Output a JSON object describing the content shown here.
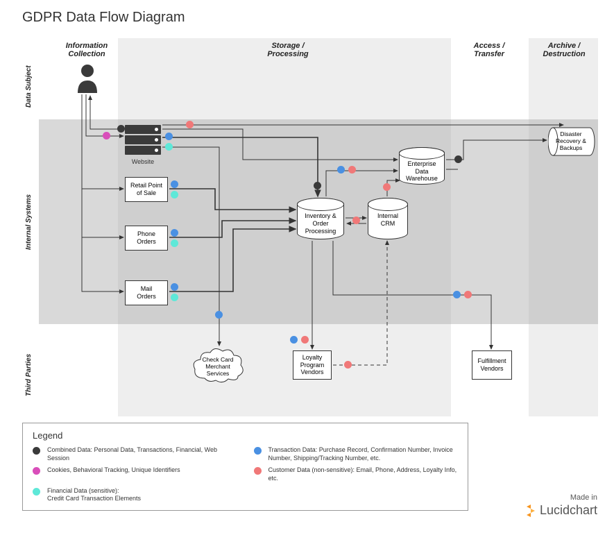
{
  "title": "GDPR Data Flow Diagram",
  "stages": {
    "collection": "Information\nCollection",
    "storage": "Storage /\nProcessing",
    "access": "Access /\nTransfer",
    "archive": "Archive /\nDestruction"
  },
  "lanes": {
    "subject": "Data Subject",
    "internal": "Internal Systems",
    "third": "Third Parties"
  },
  "nodes": {
    "website": "Website",
    "retail": "Retail Point\nof Sale",
    "phone": "Phone\nOrders",
    "mail": "Mail\nOrders",
    "inventory": "Inventory &\nOrder\nProcessing",
    "crm": "Internal\nCRM",
    "edw": "Enterprise\nData\nWarehouse",
    "disaster": "Disaster\nRecovery &\nBackups",
    "checkcard": "Check Card\nMerchant\nServices",
    "loyalty": "Loyalty\nProgram\nVendors",
    "fulfillment": "Fulfillment\nVendors"
  },
  "legend": {
    "title": "Legend",
    "combined": "Combined Data: Personal Data, Transactions, Financial, Web Session",
    "cookies": "Cookies, Behavioral Tracking, Unique Identifiers",
    "financial": "Financial Data (sensitive):\nCredit Card Transaction Elements",
    "transaction": "Transaction Data: Purchase Record, Confirmation Number, Invoice Number, Shipping/Tracking Number, etc.",
    "customer": "Customer Data (non-sensitive): Email, Phone, Address, Loyalty Info, etc."
  },
  "brand": {
    "made": "Made in",
    "name": "Lucidchart"
  }
}
